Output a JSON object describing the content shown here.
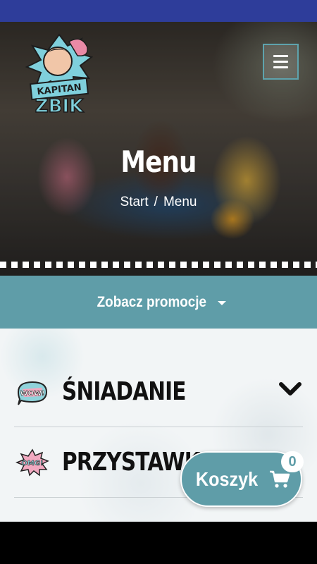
{
  "header": {
    "title": "Menu",
    "breadcrumb": {
      "home": "Start",
      "separator": "/",
      "current": "Menu"
    },
    "logo": {
      "line1": "KAPITAN",
      "line2": "ZBIK"
    }
  },
  "promo": {
    "label": "Zobacz promocje"
  },
  "categories": [
    {
      "label": "ŚNIADANIE",
      "badge": "WOW!",
      "icon": "wow-badge-icon",
      "expanded": false
    },
    {
      "label": "PRZYSTAWKI",
      "badge": "OMG!",
      "icon": "omg-badge-icon"
    }
  ],
  "cart": {
    "label": "Koszyk",
    "count": "0"
  },
  "colors": {
    "accent": "#5f9da8",
    "status_bar": "#2e3d9a"
  }
}
